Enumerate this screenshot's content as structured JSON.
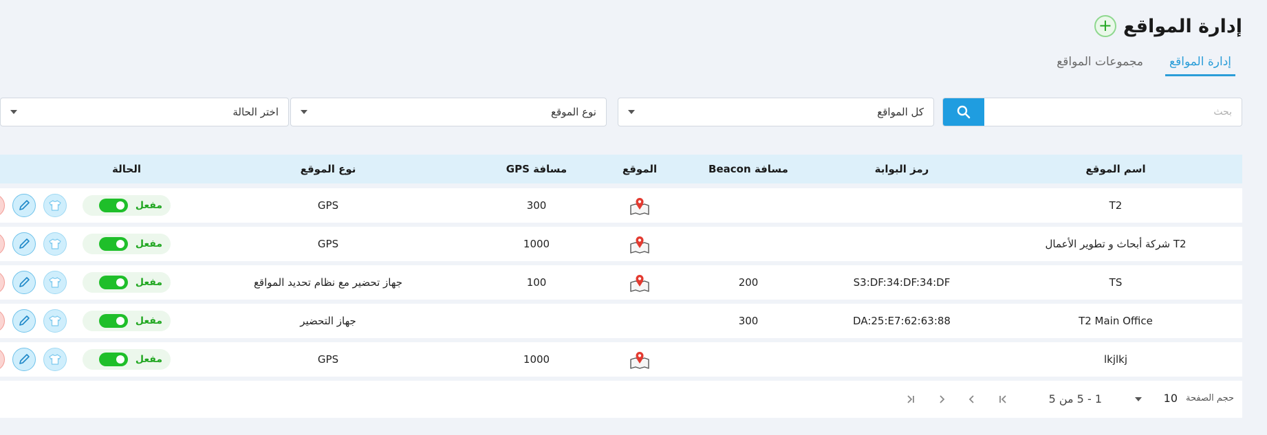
{
  "header": {
    "title": "إدارة المواقع",
    "add_icon": "plus-icon"
  },
  "tabs": [
    {
      "label": "إدارة المواقع",
      "active": true
    },
    {
      "label": "مجموعات المواقع",
      "active": false
    }
  ],
  "filters": {
    "search_placeholder": "بحث",
    "sites_select": "كل المواقع",
    "type_select": "نوع الموقع",
    "status_select": "اختر الحالة"
  },
  "table": {
    "headers": {
      "name": "اسم الموقع",
      "gate": "رمز البوابة",
      "beacon": "مسافة Beacon",
      "location": "الموقع",
      "gps": "مسافة GPS",
      "type": "نوع الموقع",
      "status": "الحالة"
    },
    "rows": [
      {
        "name": "T2",
        "gate": "",
        "beacon": "",
        "has_location": true,
        "gps": "300",
        "type": "GPS",
        "status": "مفعل"
      },
      {
        "name": "T2 شركة أبحاث و تطوير الأعمال",
        "gate": "",
        "beacon": "",
        "has_location": true,
        "gps": "1000",
        "type": "GPS",
        "status": "مفعل"
      },
      {
        "name": "TS",
        "gate": "S3:DF:34:DF:34:DF",
        "beacon": "200",
        "has_location": true,
        "gps": "100",
        "type": "جهاز تحضير مع نظام تحديد المواقع",
        "status": "مفعل"
      },
      {
        "name": "T2 Main Office",
        "gate": "DA:25:E7:62:63:88",
        "beacon": "300",
        "has_location": false,
        "gps": "",
        "type": "جهاز التحضير",
        "status": "مفعل"
      },
      {
        "name": "lkjlkj",
        "gate": "",
        "beacon": "",
        "has_location": true,
        "gps": "1000",
        "type": "GPS",
        "status": "مفعل"
      }
    ]
  },
  "pagination": {
    "page_size_label": "حجم الصفحة",
    "page_size": "10",
    "range": "1 - 5 من 5"
  },
  "colors": {
    "accent": "#1f9de0",
    "header_bg": "#ddf0fa",
    "active_green": "#1fbf2a",
    "delete_red": "#e0443b"
  }
}
